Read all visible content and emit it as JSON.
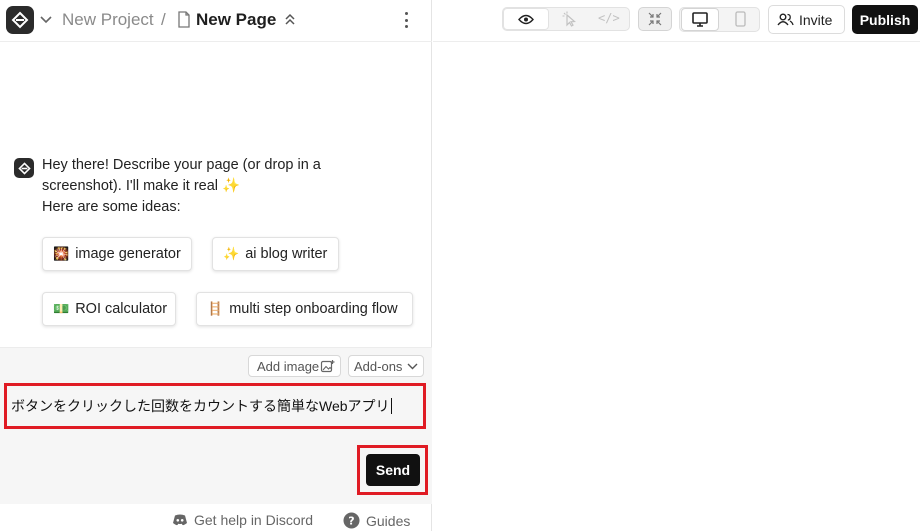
{
  "header": {
    "project_name": "New Project",
    "separator": "/",
    "page_name": "New Page"
  },
  "chat": {
    "greeting_lines": [
      "Hey there! Describe your page (or drop in a",
      "screenshot). I'll make it real ✨",
      "Here are some ideas:"
    ],
    "suggestions": [
      {
        "emoji": "🎇",
        "label": "image generator"
      },
      {
        "emoji": "✨",
        "label": "ai blog writer"
      },
      {
        "emoji": "💵",
        "label": "ROI calculator"
      },
      {
        "emoji": "🪜",
        "label": "multi step onboarding flow"
      }
    ]
  },
  "composer": {
    "add_image_label": "Add image",
    "addons_label": "Add-ons",
    "prompt_value": "ボタンをクリックした回数をカウントする簡単なWebアプリ",
    "send_label": "Send"
  },
  "footer": {
    "discord_label": "Get help in Discord",
    "guides_label": "Guides"
  },
  "toolbar": {
    "code_glyph": "</>",
    "invite_label": "Invite",
    "publish_label": "Publish"
  },
  "colors": {
    "accent_dark": "#111111",
    "highlight_red": "#e01b24"
  }
}
